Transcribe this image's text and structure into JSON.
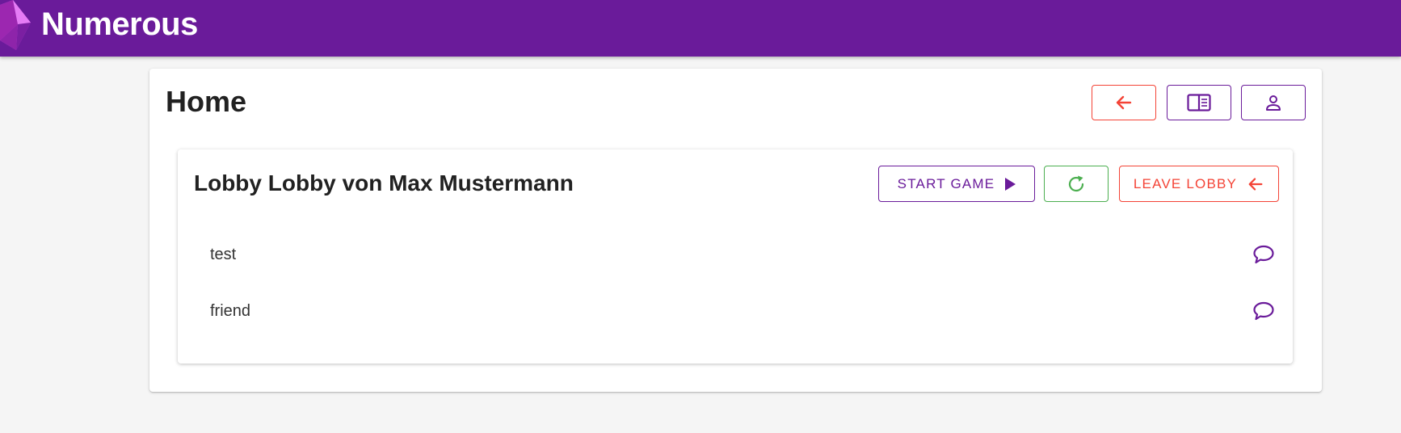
{
  "app": {
    "title": "Numerous"
  },
  "colors": {
    "primary": "#6a1b9a",
    "danger": "#f44336",
    "success": "#4caf50"
  },
  "header": {
    "title": "Home",
    "buttons": [
      {
        "icon": "arrow-left-icon"
      },
      {
        "icon": "book-icon"
      },
      {
        "icon": "person-icon"
      }
    ]
  },
  "lobby": {
    "title": "Lobby Lobby von Max Mustermann",
    "start_label": "START GAME",
    "refresh_icon": "refresh-icon",
    "leave_label": "LEAVE LOBBY",
    "members": [
      {
        "name": "test",
        "icon": "chat-bubble-icon"
      },
      {
        "name": "friend",
        "icon": "chat-bubble-icon"
      }
    ]
  }
}
